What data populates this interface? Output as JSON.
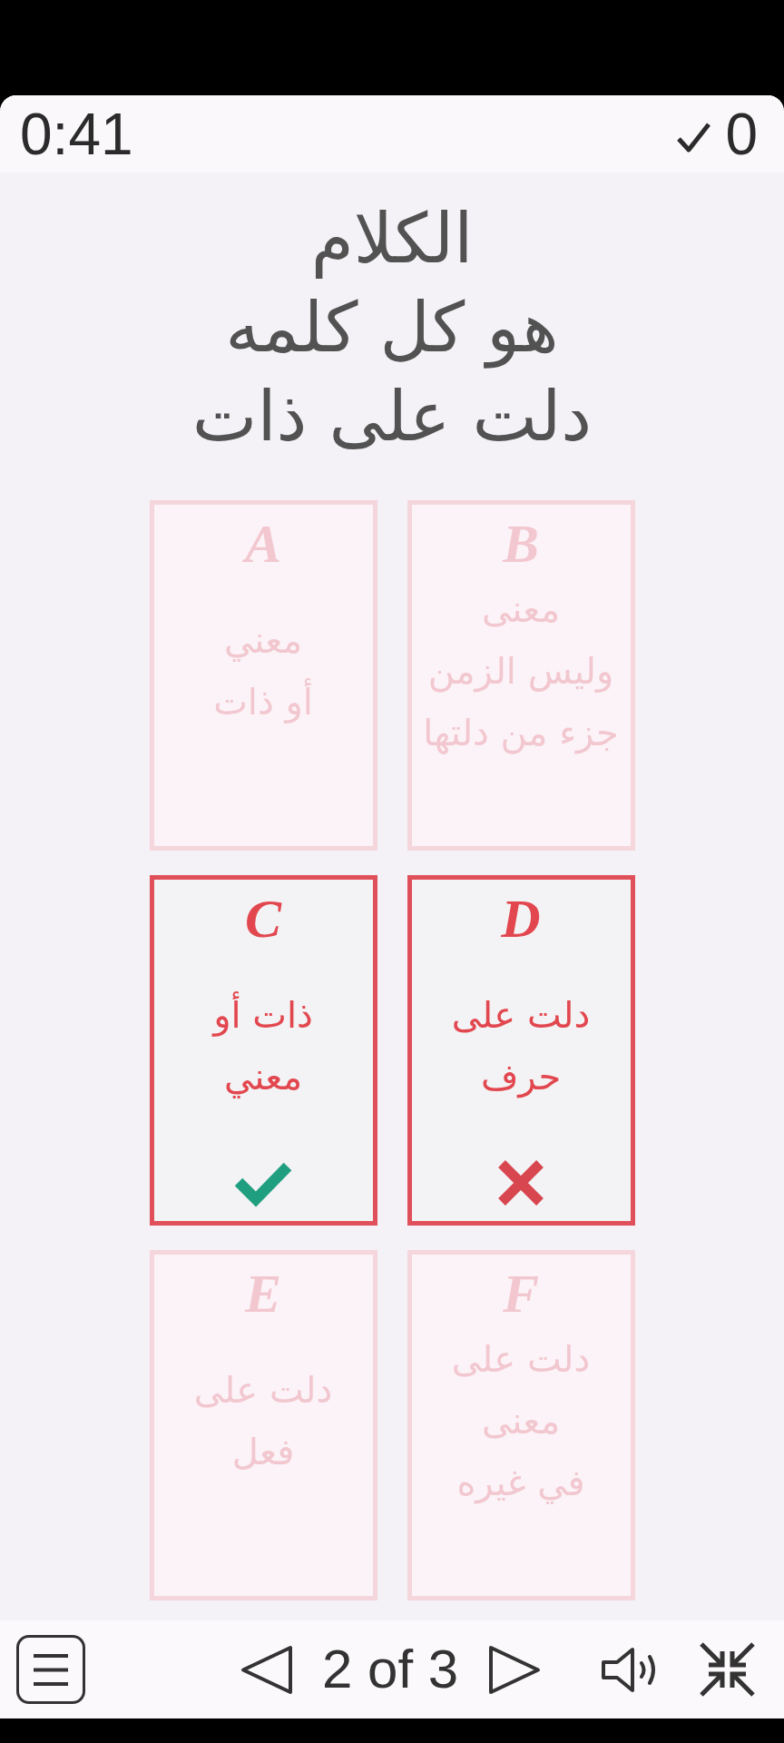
{
  "header": {
    "timer": "0:41",
    "score": "0"
  },
  "question": {
    "text": "الكلام\nهو كل كلمه\nدلت على ذات"
  },
  "options": [
    {
      "letter": "B",
      "text": "معنى\nوليس الزمن\nجزء من دلتها",
      "dimmed": true,
      "correct": false,
      "wrong": false
    },
    {
      "letter": "A",
      "text": "معني\nأو ذات",
      "dimmed": true,
      "correct": false,
      "wrong": false
    },
    {
      "letter": "D",
      "text": "دلت على\nحرف",
      "dimmed": false,
      "correct": false,
      "wrong": true
    },
    {
      "letter": "C",
      "text": "ذات أو\nمعني",
      "dimmed": false,
      "correct": true,
      "wrong": false
    },
    {
      "letter": "F",
      "text": "دلت على\nمعنى\nفي غيره",
      "dimmed": true,
      "correct": false,
      "wrong": false
    },
    {
      "letter": "E",
      "text": "دلت على\nفعل",
      "dimmed": true,
      "correct": false,
      "wrong": false
    }
  ],
  "toolbar": {
    "pager": "2 of 3"
  }
}
